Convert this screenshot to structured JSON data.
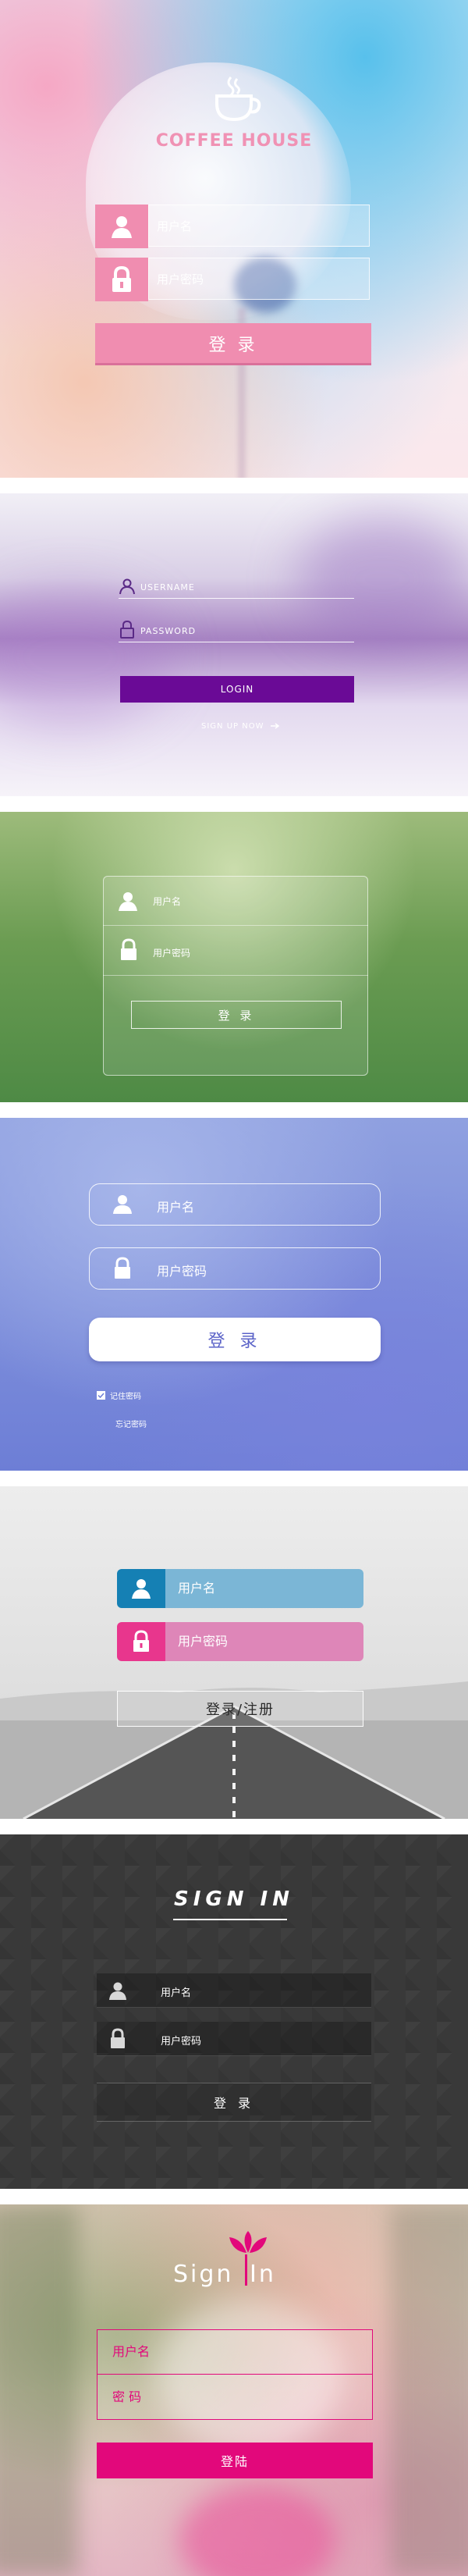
{
  "panel1": {
    "brand": "COFFEE HOUSE",
    "username_placeholder": "用户名",
    "password_placeholder": "用户密码",
    "login_label": "登 录",
    "colors": {
      "accent": "#f08db0",
      "brand_text": "#f092b4"
    },
    "icons": {
      "user": "user-icon",
      "lock": "lock-icon",
      "brand": "coffee-cup-icon"
    }
  },
  "panel2": {
    "username_placeholder": "USERNAME",
    "password_placeholder": "PASSWORD",
    "login_label": "LOGIN",
    "signup_label": "SIGN UP NOW",
    "colors": {
      "accent": "#6a0a96"
    },
    "icons": {
      "user": "user-icon",
      "lock": "lock-icon",
      "arrow": "arrow-right-icon"
    }
  },
  "panel3": {
    "username_placeholder": "用户名",
    "password_placeholder": "用户密码",
    "login_label": "登 录",
    "icons": {
      "user": "user-icon",
      "lock": "lock-icon"
    }
  },
  "panel4": {
    "username_placeholder": "用户名",
    "password_placeholder": "用户密码",
    "login_label": "登 录",
    "remember_label": "记住密码",
    "forgot_label": "忘记密码",
    "icons": {
      "user": "user-icon",
      "lock": "lock-icon",
      "check": "checkbox-icon"
    }
  },
  "panel5": {
    "username_placeholder": "用户名",
    "password_placeholder": "用户密码",
    "login_label": "登录/注册",
    "colors": {
      "user_icon_bg": "#1580b4",
      "user_field": "#7bb6d6",
      "lock_icon_bg": "#e8368d",
      "lock_field": "#de86b8"
    },
    "icons": {
      "user": "user-icon",
      "lock": "lock-icon"
    }
  },
  "panel6": {
    "title": "SIGN IN",
    "username_placeholder": "用户名",
    "password_placeholder": "用户密码",
    "login_label": "登 录",
    "icons": {
      "user": "user-icon",
      "lock": "lock-icon"
    }
  },
  "panel7": {
    "title_left": "Sign",
    "title_right": "In",
    "username_label": "用户名",
    "password_label": "密 码",
    "login_label": "登陆",
    "colors": {
      "accent": "#e2087b"
    },
    "icons": {
      "logo": "lotus-flower-icon"
    }
  }
}
